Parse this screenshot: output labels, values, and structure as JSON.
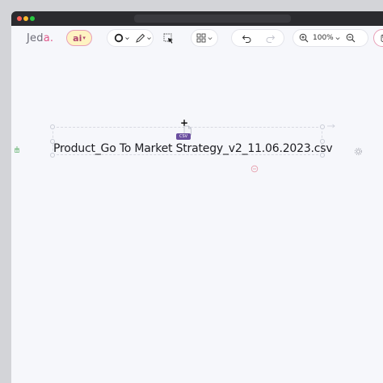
{
  "app": {
    "logo_text": "Jed",
    "logo_accent": "a.",
    "ai_label": "ai"
  },
  "toolbar": {
    "zoom_level": "100%"
  },
  "canvas": {
    "file_name": "Product_Go To Market Strategy_v2_11.06.2023.csv",
    "file_type_badge": "CSV"
  },
  "colors": {
    "accent": "#e0578a",
    "badge": "#6b4fa0"
  }
}
